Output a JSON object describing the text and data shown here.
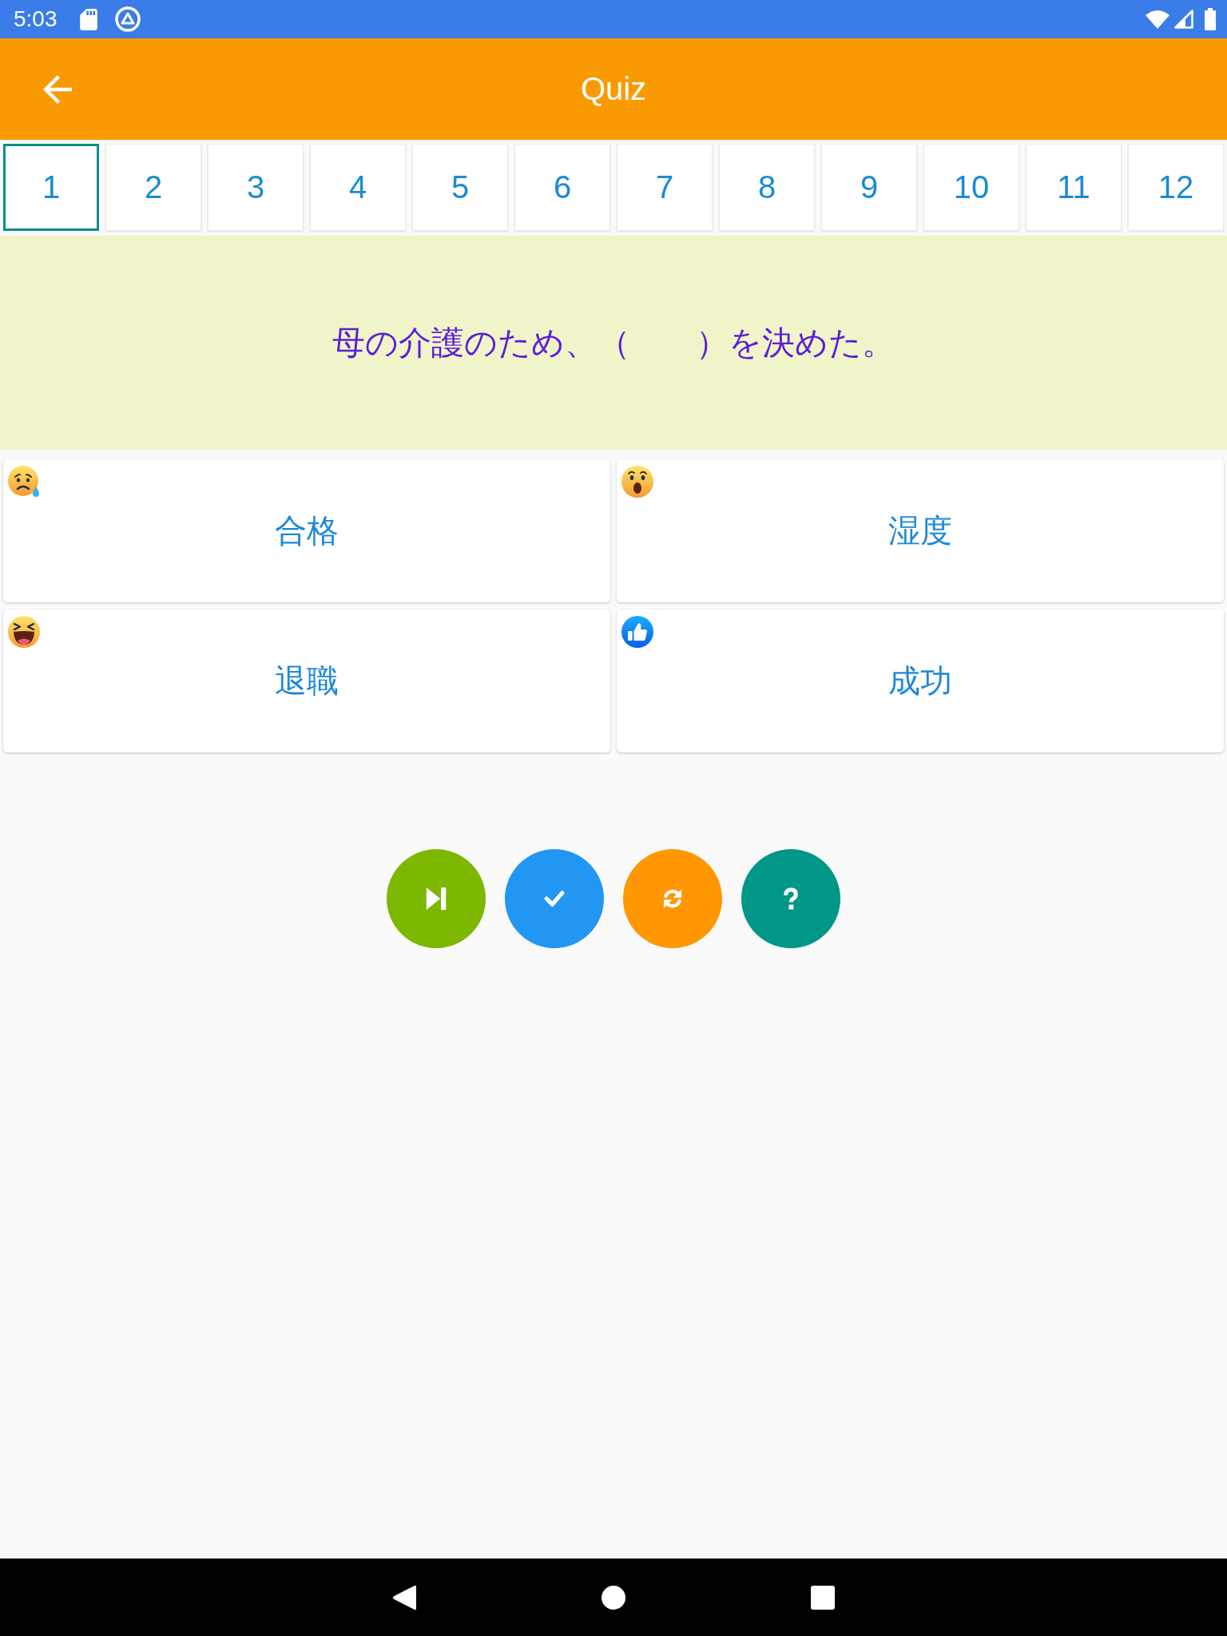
{
  "status_bar": {
    "time": "5:03"
  },
  "app_bar": {
    "title": "Quiz"
  },
  "question_tabs": [
    {
      "label": "1",
      "selected": true
    },
    {
      "label": "2",
      "selected": false
    },
    {
      "label": "3",
      "selected": false
    },
    {
      "label": "4",
      "selected": false
    },
    {
      "label": "5",
      "selected": false
    },
    {
      "label": "6",
      "selected": false
    },
    {
      "label": "7",
      "selected": false
    },
    {
      "label": "8",
      "selected": false
    },
    {
      "label": "9",
      "selected": false
    },
    {
      "label": "10",
      "selected": false
    },
    {
      "label": "11",
      "selected": false
    },
    {
      "label": "12",
      "selected": false
    }
  ],
  "question": {
    "text": "母の介護のため、（　　）を決めた。"
  },
  "answers": [
    {
      "text": "合格",
      "kind": "sad"
    },
    {
      "text": "湿度",
      "kind": "wow"
    },
    {
      "text": "退職",
      "kind": "haha"
    },
    {
      "text": "成功",
      "kind": "like"
    }
  ],
  "action_buttons": [
    {
      "kind": "skip"
    },
    {
      "kind": "check"
    },
    {
      "kind": "refresh"
    },
    {
      "kind": "help"
    }
  ]
}
